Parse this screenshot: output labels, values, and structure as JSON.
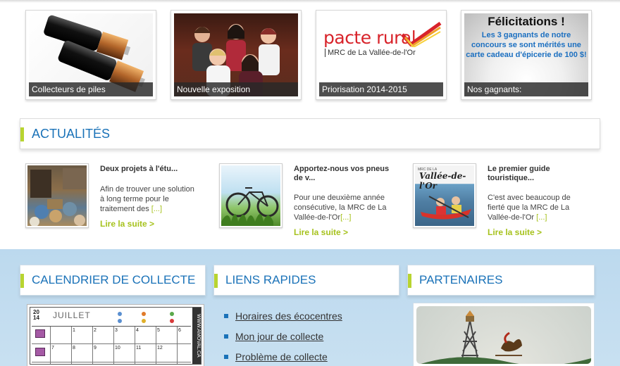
{
  "tiles": [
    {
      "caption": "Collecteurs de piles"
    },
    {
      "caption": "Nouvelle exposition"
    },
    {
      "caption": "Priorisation 2014-2015",
      "logo_main": "pacte rural",
      "logo_sub": "MRC de La Vallée-de-l'Or"
    },
    {
      "caption": "Nos gagnants:",
      "headline": "Félicitations !",
      "message": "Les 3 gagnants de notre concours se sont mérités une carte cadeau d'épicerie de 100 $!"
    }
  ],
  "actualites": {
    "title": "ACTUALITÉS",
    "items": [
      {
        "title": "Deux projets à l'étu...",
        "text": "Afin de trouver une solution à long terme pour le traitement des",
        "ellipsis": "[...]",
        "more": "Lire la suite >"
      },
      {
        "title": "Apportez-nous vos pneus de v...",
        "text": "Pour une deuxième année consécutive, la MRC de La Vallée-de-l'Or",
        "ellipsis": "[...]",
        "more": "Lire la suite >",
        "thumb": "bicycle-photo"
      },
      {
        "title": "Le premier guide touristique...",
        "text": "C'est avec beaucoup de fierté que la MRC de La Vallée-de-l'Or",
        "ellipsis": "[...]",
        "more": "Lire la suite >",
        "cover_small": "MRC DE LA",
        "cover_title": "Vallée-de-l'Or"
      }
    ]
  },
  "calendrier": {
    "title": "CALENDRIER DE COLLECTE",
    "year_top": "20",
    "year_bottom": "14",
    "month": "JUILLET",
    "side": "WWW.AMOVAL.CA",
    "numbers": [
      "1",
      "2",
      "3",
      "4",
      "5",
      "6",
      "7",
      "8",
      "9",
      "10",
      "11",
      "12"
    ]
  },
  "liens": {
    "title": "LIENS RAPIDES",
    "items": [
      "Horaires des écocentres",
      "Mon jour de collecte",
      "Problème de collecte"
    ]
  },
  "partenaires": {
    "title": "PARTENAIRES"
  },
  "colors": {
    "accent_green": "#b8d430",
    "title_blue": "#1a72b8",
    "band_blue": "#c2dcef"
  }
}
